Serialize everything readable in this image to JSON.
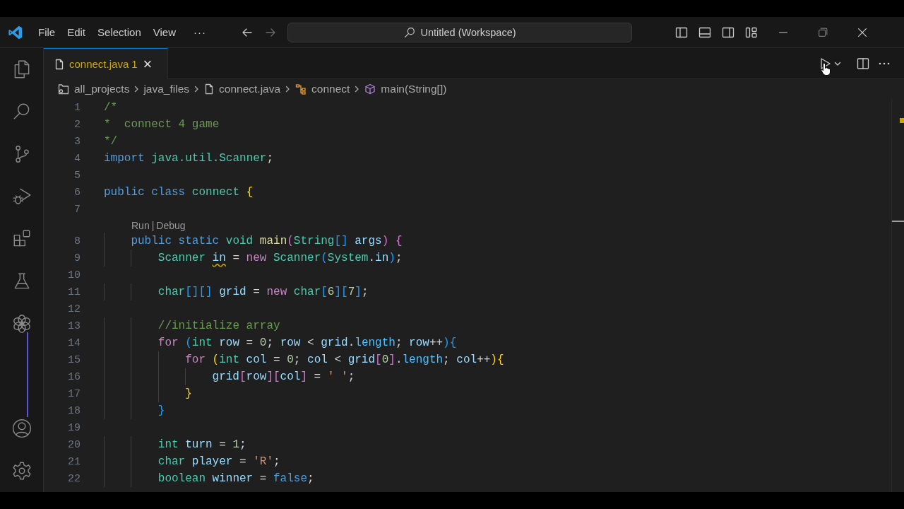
{
  "window": {
    "menus": [
      "File",
      "Edit",
      "Selection",
      "View"
    ],
    "more": "···",
    "command_center": "Untitled (Workspace)"
  },
  "tabs": [
    {
      "label": "connect.java",
      "problems": "1",
      "warning": true,
      "selected": true,
      "close": "×"
    }
  ],
  "breadcrumbs": [
    {
      "label": "all_projects",
      "kind": "root"
    },
    {
      "label": "java_files",
      "kind": "folder"
    },
    {
      "label": "connect.java",
      "kind": "file"
    },
    {
      "label": "connect",
      "kind": "class"
    },
    {
      "label": "main(String[])",
      "kind": "method"
    }
  ],
  "editor": {
    "lines": [
      {
        "kind": "code",
        "number": "1",
        "tokens": [
          {
            "text": "/*",
            "kind": "cm"
          }
        ]
      },
      {
        "kind": "code",
        "number": "2",
        "tokens": [
          {
            "text": "*  connect 4 game",
            "kind": "cm"
          }
        ]
      },
      {
        "kind": "code",
        "number": "3",
        "tokens": [
          {
            "text": "*/",
            "kind": "cm"
          }
        ]
      },
      {
        "kind": "code",
        "number": "4",
        "tokens": [
          {
            "text": "import ",
            "kind": "kw"
          },
          {
            "text": "java.util.Scanner",
            "kind": "type"
          },
          {
            "text": ";",
            "kind": "op"
          }
        ]
      },
      {
        "kind": "code",
        "number": "5"
      },
      {
        "kind": "code",
        "number": "6",
        "tokens": [
          {
            "text": "public class ",
            "kind": "kw"
          },
          {
            "text": "connect ",
            "kind": "type"
          },
          {
            "text": "{",
            "kind": "b1"
          }
        ]
      },
      {
        "kind": "code",
        "number": "7"
      },
      {
        "kind": "codelens",
        "links": [
          "Run",
          "Debug"
        ],
        "separator": "|"
      },
      {
        "kind": "code",
        "number": "8",
        "tokens": [
          {
            "text": "    public static ",
            "kind": "kw"
          },
          {
            "text": "void ",
            "kind": "type"
          },
          {
            "text": "main",
            "kind": "fn"
          },
          {
            "text": "(",
            "kind": "b2"
          },
          {
            "text": "String",
            "kind": "type"
          },
          {
            "text": "[] ",
            "kind": "b3"
          },
          {
            "text": "args",
            "kind": "var"
          },
          {
            "text": ") {",
            "kind": "b2"
          }
        ]
      },
      {
        "kind": "code",
        "number": "9",
        "tokens": [
          {
            "text": "        Scanner ",
            "kind": "type"
          },
          {
            "text": "in",
            "kind": "var",
            "warning": true
          },
          {
            "text": " = ",
            "kind": "op"
          },
          {
            "text": "new ",
            "kind": "ctrl"
          },
          {
            "text": "Scanner",
            "kind": "type"
          },
          {
            "text": "(",
            "kind": "b3"
          },
          {
            "text": "System",
            "kind": "type"
          },
          {
            "text": ".",
            "kind": "op"
          },
          {
            "text": "in",
            "kind": "var"
          },
          {
            "text": ")",
            "kind": "b3"
          },
          {
            "text": ";",
            "kind": "op"
          }
        ]
      },
      {
        "kind": "code",
        "number": "10"
      },
      {
        "kind": "code",
        "number": "11",
        "tokens": [
          {
            "text": "        char",
            "kind": "type"
          },
          {
            "text": "[][] ",
            "kind": "b3"
          },
          {
            "text": "grid",
            "kind": "var"
          },
          {
            "text": " = ",
            "kind": "op"
          },
          {
            "text": "new ",
            "kind": "ctrl"
          },
          {
            "text": "char",
            "kind": "type"
          },
          {
            "text": "[",
            "kind": "b3"
          },
          {
            "text": "6",
            "kind": "num"
          },
          {
            "text": "][",
            "kind": "b3"
          },
          {
            "text": "7",
            "kind": "num"
          },
          {
            "text": "]",
            "kind": "b3"
          },
          {
            "text": ";",
            "kind": "op"
          }
        ]
      },
      {
        "kind": "code",
        "number": "12"
      },
      {
        "kind": "code",
        "number": "13",
        "tokens": [
          {
            "text": "        //initialize array",
            "kind": "cm"
          }
        ]
      },
      {
        "kind": "code",
        "number": "14",
        "tokens": [
          {
            "text": "        for ",
            "kind": "ctrl"
          },
          {
            "text": "(",
            "kind": "b3"
          },
          {
            "text": "int ",
            "kind": "type"
          },
          {
            "text": "row",
            "kind": "var"
          },
          {
            "text": " = ",
            "kind": "op"
          },
          {
            "text": "0",
            "kind": "num"
          },
          {
            "text": "; ",
            "kind": "op"
          },
          {
            "text": "row",
            "kind": "var"
          },
          {
            "text": " < ",
            "kind": "op"
          },
          {
            "text": "grid",
            "kind": "var"
          },
          {
            "text": ".",
            "kind": "op"
          },
          {
            "text": "length",
            "kind": "prop"
          },
          {
            "text": "; ",
            "kind": "op"
          },
          {
            "text": "row",
            "kind": "var"
          },
          {
            "text": "++",
            "kind": "op"
          },
          {
            "text": "){",
            "kind": "b3"
          }
        ]
      },
      {
        "kind": "code",
        "number": "15",
        "tokens": [
          {
            "text": "            for ",
            "kind": "ctrl"
          },
          {
            "text": "(",
            "kind": "b1"
          },
          {
            "text": "int ",
            "kind": "type"
          },
          {
            "text": "col",
            "kind": "var"
          },
          {
            "text": " = ",
            "kind": "op"
          },
          {
            "text": "0",
            "kind": "num"
          },
          {
            "text": "; ",
            "kind": "op"
          },
          {
            "text": "col",
            "kind": "var"
          },
          {
            "text": " < ",
            "kind": "op"
          },
          {
            "text": "grid",
            "kind": "var"
          },
          {
            "text": "[",
            "kind": "b2"
          },
          {
            "text": "0",
            "kind": "num"
          },
          {
            "text": "]",
            "kind": "b2"
          },
          {
            "text": ".",
            "kind": "op"
          },
          {
            "text": "length",
            "kind": "prop"
          },
          {
            "text": "; ",
            "kind": "op"
          },
          {
            "text": "col",
            "kind": "var"
          },
          {
            "text": "++",
            "kind": "op"
          },
          {
            "text": "){",
            "kind": "b1"
          }
        ]
      },
      {
        "kind": "code",
        "number": "16",
        "tokens": [
          {
            "text": "                grid",
            "kind": "var"
          },
          {
            "text": "[",
            "kind": "b2"
          },
          {
            "text": "row",
            "kind": "var"
          },
          {
            "text": "][",
            "kind": "b2"
          },
          {
            "text": "col",
            "kind": "var"
          },
          {
            "text": "]",
            "kind": "b2"
          },
          {
            "text": " = ",
            "kind": "op"
          },
          {
            "text": "' '",
            "kind": "str"
          },
          {
            "text": ";",
            "kind": "op"
          }
        ]
      },
      {
        "kind": "code",
        "number": "17",
        "tokens": [
          {
            "text": "            }",
            "kind": "b1"
          }
        ]
      },
      {
        "kind": "code",
        "number": "18",
        "tokens": [
          {
            "text": "        }",
            "kind": "b3"
          }
        ]
      },
      {
        "kind": "code",
        "number": "19"
      },
      {
        "kind": "code",
        "number": "20",
        "tokens": [
          {
            "text": "        int ",
            "kind": "type"
          },
          {
            "text": "turn",
            "kind": "var"
          },
          {
            "text": " = ",
            "kind": "op"
          },
          {
            "text": "1",
            "kind": "num"
          },
          {
            "text": ";",
            "kind": "op"
          }
        ]
      },
      {
        "kind": "code",
        "number": "21",
        "tokens": [
          {
            "text": "        char ",
            "kind": "type"
          },
          {
            "text": "player",
            "kind": "var"
          },
          {
            "text": " = ",
            "kind": "op"
          },
          {
            "text": "'R'",
            "kind": "str"
          },
          {
            "text": ";",
            "kind": "op"
          }
        ]
      },
      {
        "kind": "code",
        "number": "22",
        "tokens": [
          {
            "text": "        boolean ",
            "kind": "type"
          },
          {
            "text": "winner",
            "kind": "var"
          },
          {
            "text": " = ",
            "kind": "op"
          },
          {
            "text": "false",
            "kind": "kw"
          },
          {
            "text": ";",
            "kind": "op"
          }
        ]
      }
    ]
  }
}
